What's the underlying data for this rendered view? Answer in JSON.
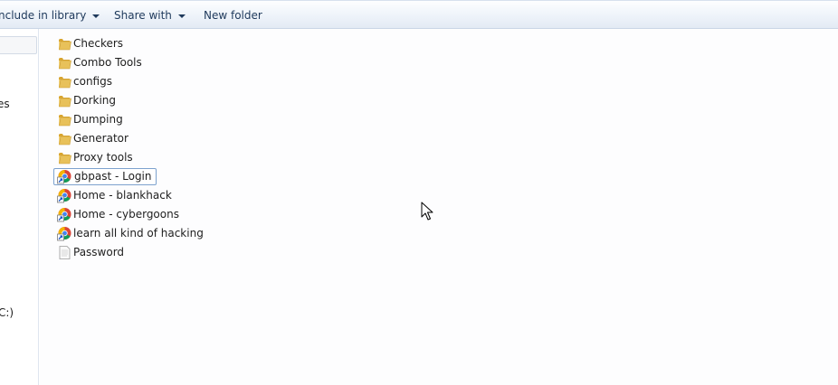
{
  "toolbar": {
    "include_library_label": "nclude in library",
    "share_with_label": "Share with",
    "new_folder_label": "New folder"
  },
  "nav": {
    "partial_label_1": "es",
    "partial_label_2": "C:)"
  },
  "files": [
    {
      "name": "Checkers",
      "icon": "folder-icon"
    },
    {
      "name": "Combo Tools",
      "icon": "folder-icon"
    },
    {
      "name": "configs",
      "icon": "folder-icon"
    },
    {
      "name": "Dorking",
      "icon": "folder-icon"
    },
    {
      "name": "Dumping",
      "icon": "folder-icon"
    },
    {
      "name": "Generator",
      "icon": "folder-icon"
    },
    {
      "name": "Proxy tools",
      "icon": "folder-icon"
    },
    {
      "name": "gbpast - Login",
      "icon": "chrome-shortcut-icon",
      "selected": true
    },
    {
      "name": "Home - blankhack",
      "icon": "chrome-shortcut-icon"
    },
    {
      "name": "Home - cybergoons",
      "icon": "chrome-shortcut-icon"
    },
    {
      "name": "learn all kind of hacking",
      "icon": "chrome-shortcut-icon"
    },
    {
      "name": "Password",
      "icon": "text-file-icon"
    }
  ],
  "colors": {
    "toolbar_text": "#1e395b",
    "selection_border": "#7da2ce",
    "folder": "#e8c15a"
  }
}
